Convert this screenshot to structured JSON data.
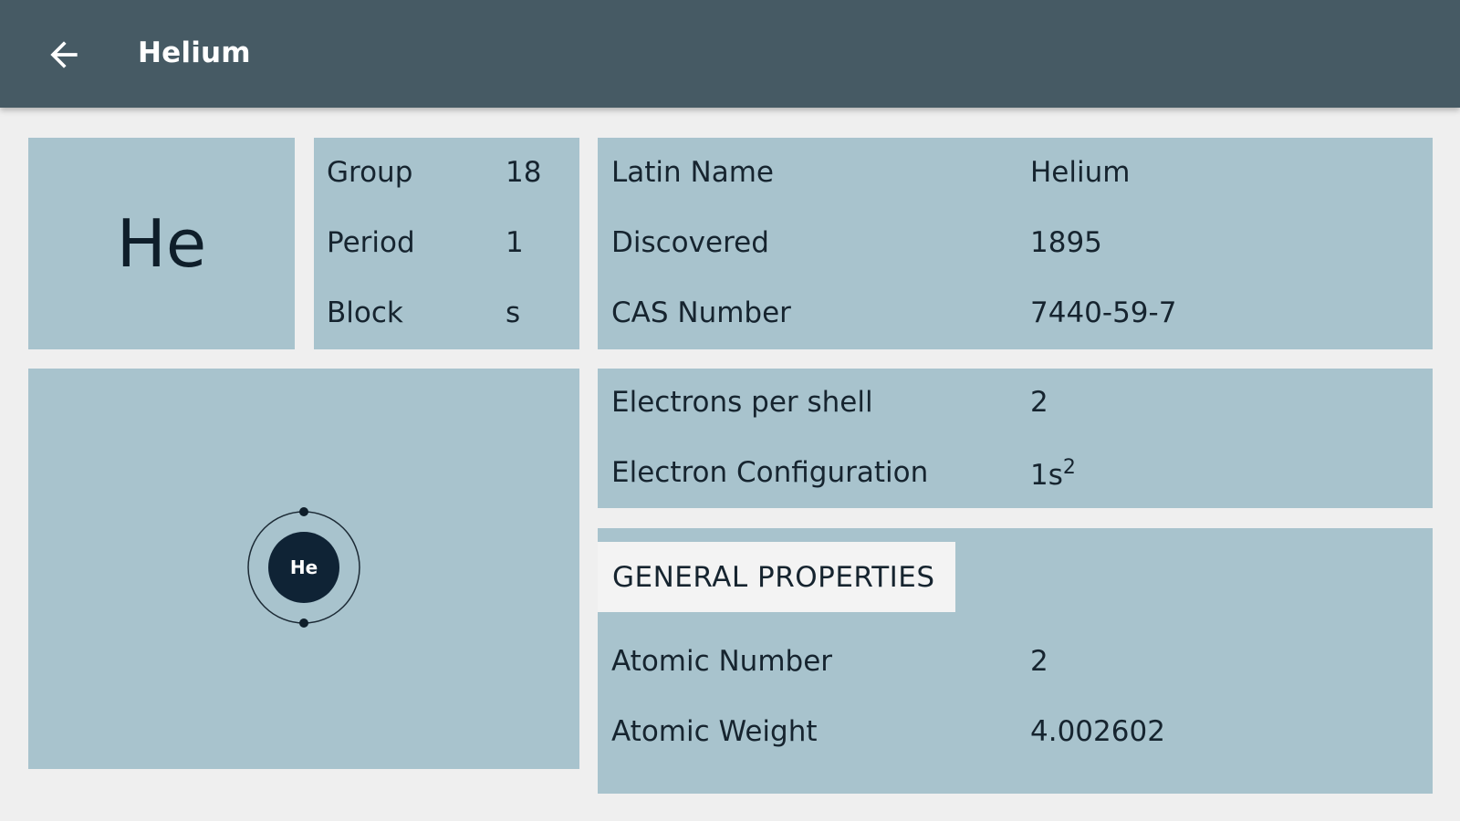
{
  "header": {
    "title": "Helium",
    "back_icon": "arrow-left-icon"
  },
  "symbol_card": {
    "symbol": "He"
  },
  "group_card": {
    "rows": [
      {
        "label": "Group",
        "value": "18"
      },
      {
        "label": "Period",
        "value": "1"
      },
      {
        "label": "Block",
        "value": "s"
      }
    ]
  },
  "info_card": {
    "rows": [
      {
        "label": "Latin Name",
        "value": "Helium"
      },
      {
        "label": "Discovered",
        "value": "1895"
      },
      {
        "label": "CAS Number",
        "value": "7440-59-7"
      }
    ]
  },
  "electron_card": {
    "shell_label": "Electrons per shell",
    "shell_value": "2",
    "config_label": "Electron Configuration",
    "config_base": "1s",
    "config_sup": "2"
  },
  "atom_diagram": {
    "nucleus_label": "He",
    "electron_count": 2
  },
  "general_properties": {
    "section_title": "GENERAL PROPERTIES",
    "rows": [
      {
        "label": "Atomic Number",
        "value": "2"
      },
      {
        "label": "Atomic Weight",
        "value": "4.002602"
      }
    ]
  },
  "colors": {
    "toolbar": "#465a64",
    "card": "#a8c3cd",
    "background": "#efefef",
    "text_dark": "#16242f",
    "nucleus": "#0f2335"
  }
}
